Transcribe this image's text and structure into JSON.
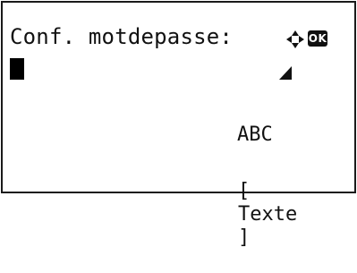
{
  "screen": {
    "prompt": "Conf. motdepasse:",
    "input_mode": "ABC",
    "softkey": {
      "open_bracket": "[",
      "label": "Texte",
      "close_bracket": "]"
    },
    "icons": {
      "navigation": "four-way-arrow-icon",
      "ok": "ok-badge-icon",
      "cursor": "text-cursor-block",
      "indicator": "corner-triangle-icon"
    },
    "ok_label": "OK",
    "colors": {
      "foreground": "#111111",
      "background": "#ffffff"
    }
  }
}
